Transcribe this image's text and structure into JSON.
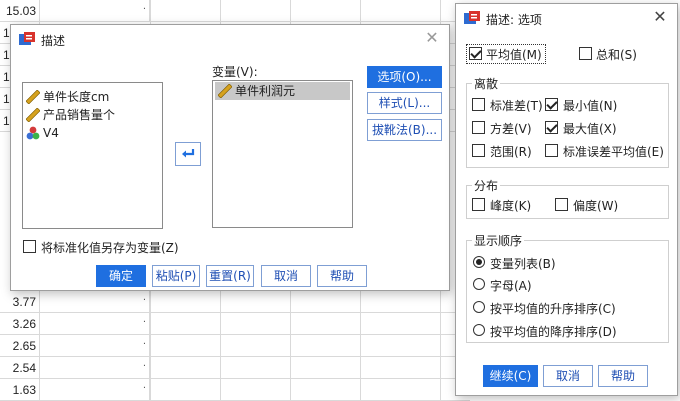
{
  "sheet": {
    "top_value": "15.03",
    "rows": [
      "3.77",
      "3.26",
      "2.65",
      "2.54",
      "1.63"
    ],
    "left_col_fragments": [
      "1",
      "1",
      "1",
      "1",
      "1"
    ],
    "dot": "."
  },
  "describe_dialog": {
    "title": "描述",
    "source_vars": [
      {
        "label": "单件长度cm",
        "icon": "ruler-icon"
      },
      {
        "label": "产品销售量个",
        "icon": "ruler-icon"
      },
      {
        "label": "V4",
        "icon": "nominal-icon"
      }
    ],
    "variables_label": "变量(V):",
    "selected_vars": [
      {
        "label": "单件利润元",
        "icon": "ruler-icon"
      }
    ],
    "move_button_icon": "arrow-icon",
    "side_buttons": {
      "options": "选项(O)...",
      "style": "样式(L)...",
      "bootstrap": "拔靴法(B)..."
    },
    "save_standardized": {
      "label": "将标准化值另存为变量(Z)",
      "checked": false
    },
    "bottom_buttons": {
      "ok": "确定",
      "paste": "粘贴(P)",
      "reset": "重置(R)",
      "cancel": "取消",
      "help": "帮助"
    }
  },
  "options_dialog": {
    "title": "描述: 选项",
    "mean": {
      "label": "平均值(M)",
      "checked": true
    },
    "sum": {
      "label": "总和(S)",
      "checked": false
    },
    "dispersion": {
      "title": "离散",
      "std_dev": {
        "label": "标准差(T)",
        "checked": false
      },
      "min": {
        "label": "最小值(N)",
        "checked": true
      },
      "variance": {
        "label": "方差(V)",
        "checked": false
      },
      "max": {
        "label": "最大值(X)",
        "checked": true
      },
      "range": {
        "label": "范围(R)",
        "checked": false
      },
      "se_mean": {
        "label": "标准误差平均值(E)",
        "checked": false
      }
    },
    "distribution": {
      "title": "分布",
      "kurtosis": {
        "label": "峰度(K)",
        "checked": false
      },
      "skewness": {
        "label": "偏度(W)",
        "checked": false
      }
    },
    "display_order": {
      "title": "显示顺序",
      "options": [
        {
          "label": "变量列表(B)",
          "selected": true
        },
        {
          "label": "字母(A)",
          "selected": false
        },
        {
          "label": "按平均值的升序排序(C)",
          "selected": false
        },
        {
          "label": "按平均值的降序排序(D)",
          "selected": false
        }
      ]
    },
    "buttons": {
      "continue": "继续(C)",
      "cancel": "取消",
      "help": "帮助"
    }
  },
  "colors": {
    "primary": "#1f6fe0",
    "accent_text": "#1f4fb4",
    "selection": "#c8c8c8"
  }
}
